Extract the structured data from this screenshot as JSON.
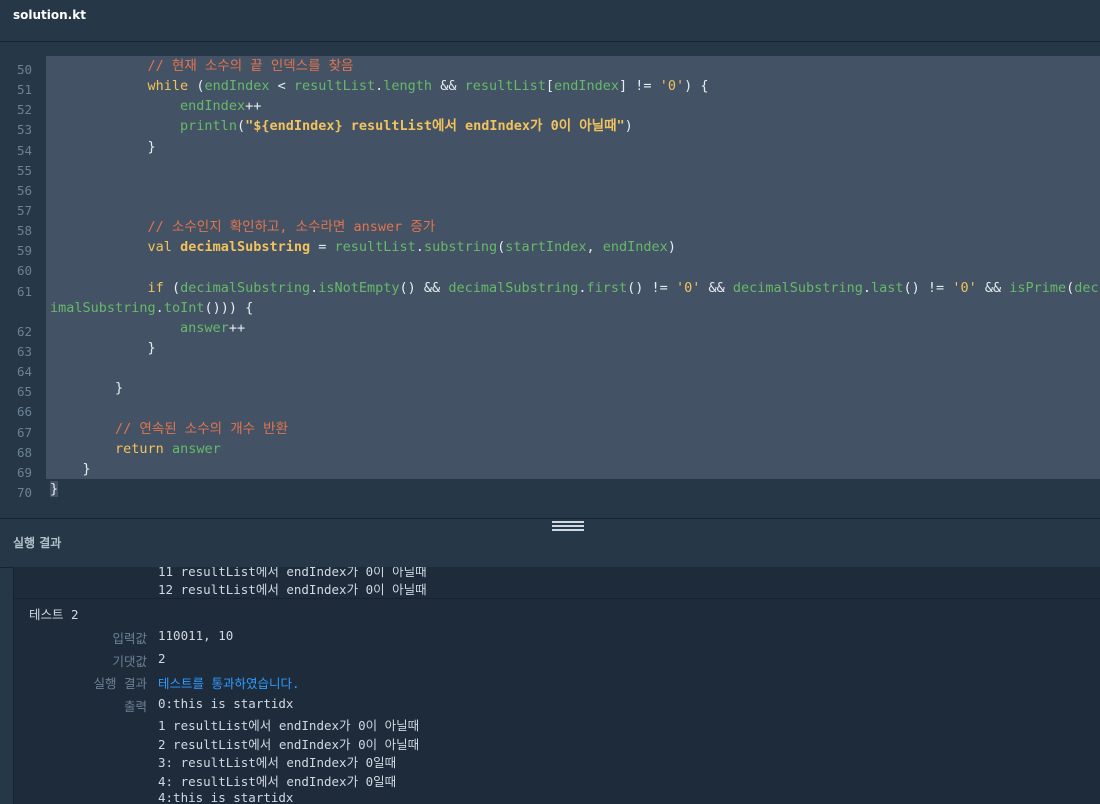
{
  "tab": {
    "title": "solution.kt"
  },
  "editor": {
    "line_numbers": [
      "50",
      "51",
      "52",
      "53",
      "54",
      "55",
      "56",
      "57",
      "58",
      "59",
      "60",
      "61",
      "62",
      "63",
      "64",
      "65",
      "66",
      "67",
      "68",
      "69",
      "70"
    ]
  },
  "results": {
    "title": "실행 결과",
    "prev_output_lines": [
      "11 resultList에서 endIndex가 0이 아닐때",
      "12 resultList에서 endIndex가 0이 아닐때"
    ],
    "test_name": "테스트 2",
    "rows": [
      {
        "label": "입력값",
        "value": "110011, 10"
      },
      {
        "label": "기댓값",
        "value": "2"
      },
      {
        "label": "실행 결과",
        "value": "테스트를 통과하였습니다."
      },
      {
        "label": "출력",
        "value": "0:this is startidx"
      }
    ],
    "output_lines": [
      "1 resultList에서 endIndex가 0이 아닐때",
      "2 resultList에서 endIndex가 0이 아닐때",
      "3: resultList에서 endIndex가 0일때",
      "4: resultList에서 endIndex가 0일때",
      "4:this is startidx"
    ]
  },
  "colors": {
    "background": "#263747",
    "selection": "#435264",
    "keyword": "#f2c35d",
    "identifier": "#67b96a",
    "comment": "#e2754f",
    "pass": "#2f9bff"
  }
}
